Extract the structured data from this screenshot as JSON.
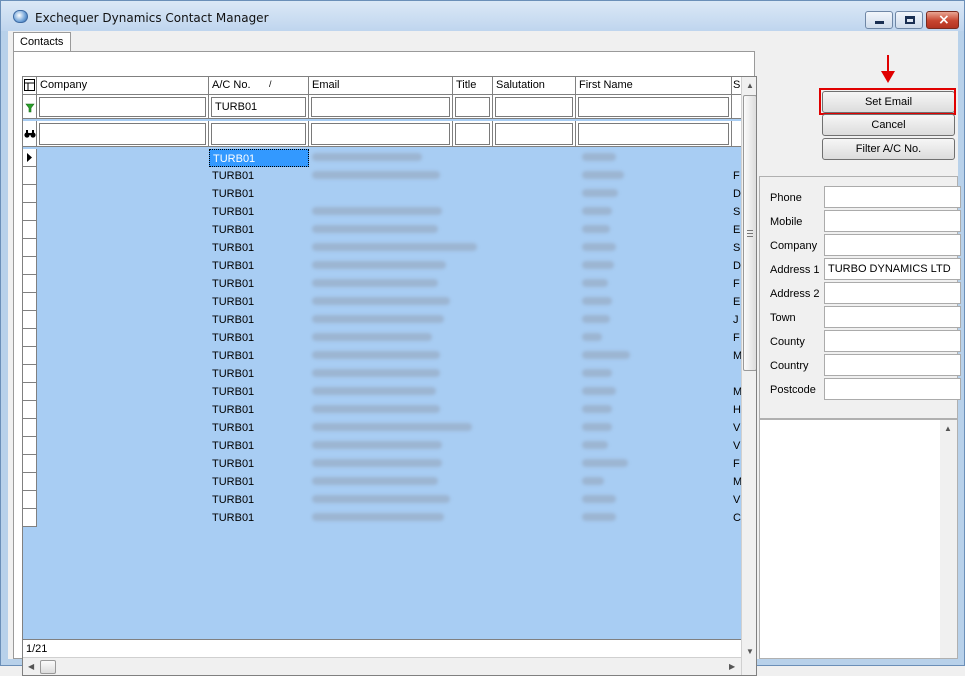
{
  "window": {
    "title": "Exchequer Dynamics Contact Manager"
  },
  "tabs": [
    {
      "label": "Contacts"
    }
  ],
  "grid": {
    "columns": [
      {
        "label": "Company"
      },
      {
        "label": "A/C No.",
        "sort": "/"
      },
      {
        "label": "Email"
      },
      {
        "label": "Title"
      },
      {
        "label": "Salutation"
      },
      {
        "label": "First Name"
      },
      {
        "label": "S"
      }
    ],
    "filter_row": {
      "ac_no": "TURB01"
    },
    "rows": [
      {
        "ac_no": "TURB01",
        "email_w": 110,
        "name_w": 34,
        "extra": ""
      },
      {
        "ac_no": "TURB01",
        "email_w": 128,
        "name_w": 42,
        "extra": "F"
      },
      {
        "ac_no": "TURB01",
        "email_w": 0,
        "name_w": 36,
        "extra": "D"
      },
      {
        "ac_no": "TURB01",
        "email_w": 130,
        "name_w": 30,
        "extra": "S"
      },
      {
        "ac_no": "TURB01",
        "email_w": 126,
        "name_w": 28,
        "extra": "E"
      },
      {
        "ac_no": "TURB01",
        "email_w": 165,
        "name_w": 34,
        "extra": "S"
      },
      {
        "ac_no": "TURB01",
        "email_w": 134,
        "name_w": 32,
        "extra": "D"
      },
      {
        "ac_no": "TURB01",
        "email_w": 126,
        "name_w": 26,
        "extra": "F"
      },
      {
        "ac_no": "TURB01",
        "email_w": 138,
        "name_w": 30,
        "extra": "E"
      },
      {
        "ac_no": "TURB01",
        "email_w": 132,
        "name_w": 28,
        "extra": "J"
      },
      {
        "ac_no": "TURB01",
        "email_w": 120,
        "name_w": 20,
        "extra": "F"
      },
      {
        "ac_no": "TURB01",
        "email_w": 128,
        "name_w": 48,
        "extra": "M"
      },
      {
        "ac_no": "TURB01",
        "email_w": 128,
        "name_w": 30,
        "extra": ""
      },
      {
        "ac_no": "TURB01",
        "email_w": 124,
        "name_w": 34,
        "extra": "M"
      },
      {
        "ac_no": "TURB01",
        "email_w": 128,
        "name_w": 30,
        "extra": "H"
      },
      {
        "ac_no": "TURB01",
        "email_w": 160,
        "name_w": 30,
        "extra": "V"
      },
      {
        "ac_no": "TURB01",
        "email_w": 130,
        "name_w": 26,
        "extra": "V"
      },
      {
        "ac_no": "TURB01",
        "email_w": 130,
        "name_w": 46,
        "extra": "F"
      },
      {
        "ac_no": "TURB01",
        "email_w": 126,
        "name_w": 22,
        "extra": "M"
      },
      {
        "ac_no": "TURB01",
        "email_w": 138,
        "name_w": 34,
        "extra": "V"
      },
      {
        "ac_no": "TURB01",
        "email_w": 132,
        "name_w": 34,
        "extra": "C"
      }
    ],
    "status": "1/21"
  },
  "buttons": {
    "set_email": "Set Email",
    "cancel": "Cancel",
    "filter_ac": "Filter A/C No."
  },
  "details": [
    {
      "label": "Phone",
      "value": ""
    },
    {
      "label": "Mobile",
      "value": ""
    },
    {
      "label": "Company",
      "value": ""
    },
    {
      "label": "Address 1",
      "value": "TURBO DYNAMICS LTD"
    },
    {
      "label": "Address 2",
      "value": ""
    },
    {
      "label": "Town",
      "value": ""
    },
    {
      "label": "County",
      "value": ""
    },
    {
      "label": "Country",
      "value": ""
    },
    {
      "label": "Postcode",
      "value": ""
    }
  ],
  "colors": {
    "highlight": "#e00000",
    "grid_bg": "#a8cdf3",
    "selected": "#3399ff"
  }
}
